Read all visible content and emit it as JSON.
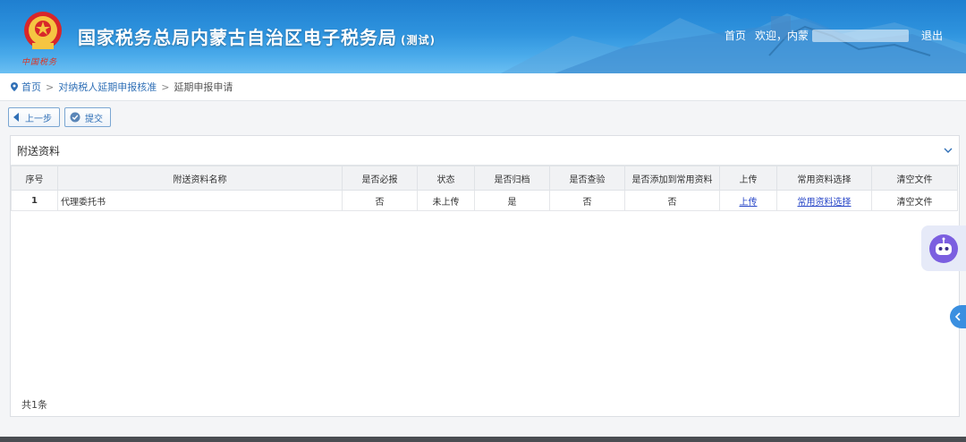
{
  "header": {
    "title": "国家税务总局内蒙古自治区电子税务局",
    "title_suffix": "(测试)",
    "logo_subtext": "中国税务",
    "nav": {
      "home": "首页",
      "welcome": "欢迎，内蒙",
      "logout": "退出"
    }
  },
  "breadcrumb": {
    "items": [
      "首页",
      "对纳税人延期申报核准",
      "延期申报申请"
    ]
  },
  "toolbar": {
    "prev_label": "上一步",
    "submit_label": "提交"
  },
  "panel": {
    "title": "附送资料",
    "columns": [
      "序号",
      "附送资料名称",
      "是否必报",
      "状态",
      "是否归档",
      "是否查验",
      "是否添加到常用资料",
      "上传",
      "常用资料选择",
      "清空文件"
    ],
    "rows": [
      {
        "index": "1",
        "name": "代理委托书",
        "required": "否",
        "status": "未上传",
        "archived": "是",
        "verified": "否",
        "add_common": "否",
        "upload": "上传",
        "common_select": "常用资料选择",
        "clear": "清空文件"
      }
    ],
    "total": "共1条"
  },
  "colors": {
    "accent": "#2f6fb6",
    "link": "#2a48c8",
    "header_top": "#1f7fd0",
    "header_bottom": "#6bbff2"
  }
}
